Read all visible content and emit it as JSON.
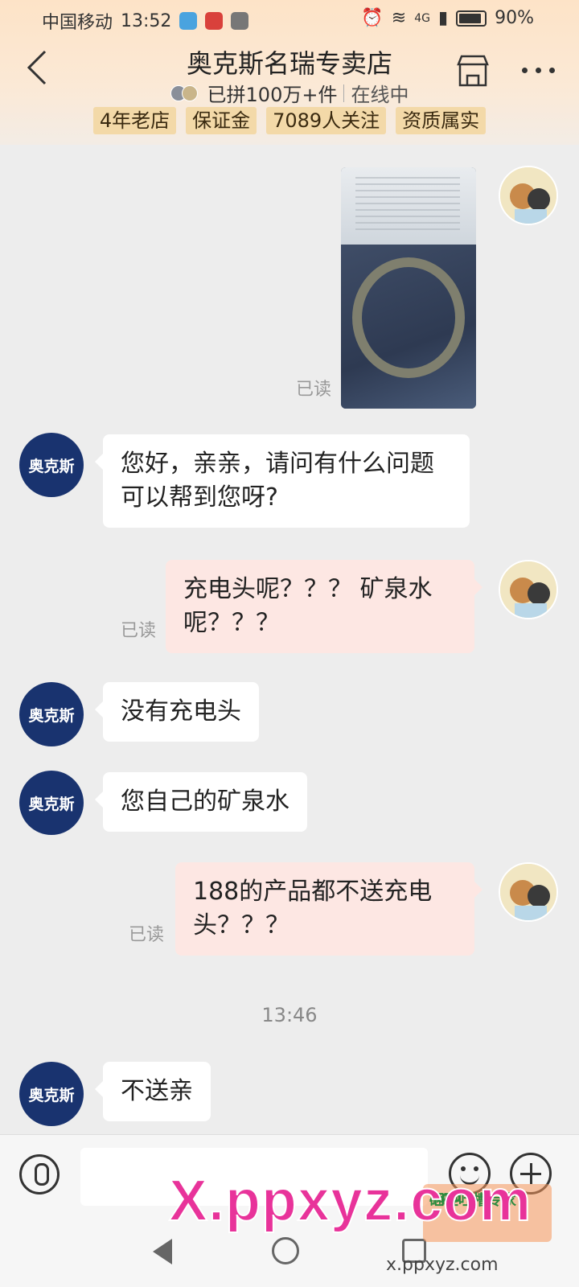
{
  "status_bar": {
    "carrier": "中国移动",
    "time": "13:52",
    "network": "4G",
    "battery": "90%"
  },
  "header": {
    "title": "奥克斯名瑞专卖店",
    "sales": "已拼100万+件",
    "status": "在线中",
    "tags": [
      "4年老店",
      "保证金",
      "7089人关注",
      "资质属实"
    ]
  },
  "icons": {
    "back": "back-chevron-icon",
    "shop": "shop-icon",
    "more": "more-dots-icon",
    "mic": "microphone-icon",
    "emoji": "emoji-icon",
    "plus": "plus-icon"
  },
  "colors": {
    "header_gradient_top": "#fde3c7",
    "tag_bg": "#f3d9a8",
    "seller_avatar": "#19336f",
    "my_bubble": "#fde7e3",
    "their_bubble": "#ffffff",
    "watermark": "#e8339a"
  },
  "messages": [
    {
      "from": "me",
      "type": "image",
      "read": "已读"
    },
    {
      "from": "shop",
      "avatar_label": "奥克斯",
      "text": "您好，亲亲，请问有什么问题可以帮到您呀?"
    },
    {
      "from": "me",
      "text": "充电头呢？？？ 矿泉水呢？？？",
      "read": "已读"
    },
    {
      "from": "shop",
      "avatar_label": "奥克斯",
      "text": "没有充电头"
    },
    {
      "from": "shop",
      "avatar_label": "奥克斯",
      "text": "您自己的矿泉水"
    },
    {
      "from": "me",
      "text": "188的产品都不送充电头？？？",
      "read": "已读"
    },
    {
      "from": "shop",
      "avatar_label": "奥克斯",
      "text": "不送亲"
    }
  ],
  "timestamp": "13:46",
  "input": {
    "value": "",
    "placeholder": ""
  },
  "watermark": {
    "main": "X.ppxyz.com",
    "small": "x.ppxyz.com",
    "badge": "砸砸吐槽专家",
    "badge_app": "App"
  }
}
